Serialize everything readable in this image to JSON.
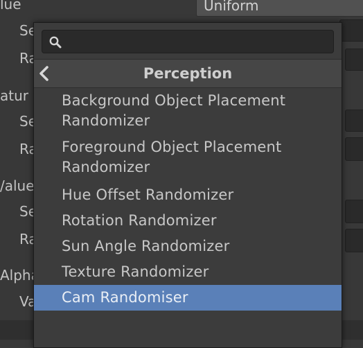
{
  "inspector": {
    "labels": [
      "lue",
      "Se",
      "Ra",
      "atur",
      "Se",
      "Ra",
      "/alue",
      "Se",
      "Ra",
      "Alpha",
      "Va"
    ],
    "dropdown_value": "Uniform"
  },
  "popup": {
    "search": {
      "value": "",
      "placeholder": ""
    },
    "header_title": "Perception",
    "items": [
      {
        "label": "Background Object Placement Randomizer"
      },
      {
        "label": "Foreground Object Placement Randomizer"
      },
      {
        "label": "Hue Offset Randomizer"
      },
      {
        "label": "Rotation Randomizer"
      },
      {
        "label": "Sun Angle Randomizer"
      },
      {
        "label": "Texture Randomizer"
      },
      {
        "label": "Cam Randomiser",
        "selected": true
      }
    ]
  },
  "colors": {
    "selection": "#5a80b8",
    "popup_bg": "#3c3c3c",
    "panel_bg": "#383838"
  }
}
